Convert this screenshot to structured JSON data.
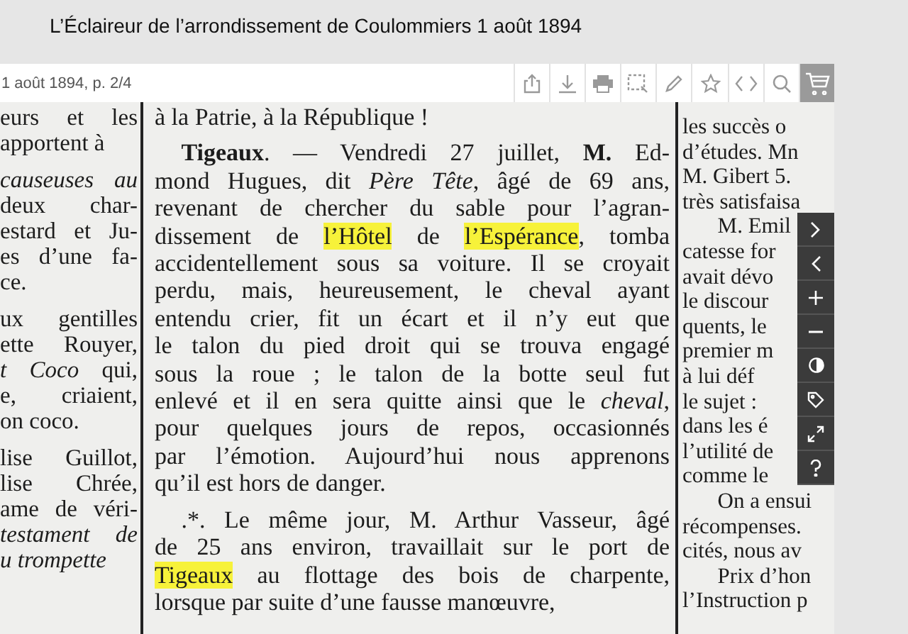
{
  "header": {
    "title": "L’Éclaireur de l’arrondissement de Coulommiers 1 août 1894"
  },
  "toolbar": {
    "page_label": "1 août 1894, p. 2/4"
  },
  "document": {
    "columns": [
      {
        "kind": "cut_left",
        "paragraphs": [
          {
            "lines": [
              "eurs et les",
              "apportent à"
            ]
          },
          {
            "lines": [
              "*causeuses au*",
              "deux char-",
              "estard et Ju-",
              "es d’une fa-",
              "ce."
            ]
          },
          {
            "lines": [
              "ux gentilles",
              "ette Rouyer,",
              "*t Coco* qui,",
              "e, criaient,",
              "on coco."
            ]
          },
          {
            "lines": [
              "lise Guillot,",
              "lise Chrée,",
              "ame de véri-",
              "*testament de*",
              "*u trompette*"
            ]
          }
        ]
      },
      {
        "kind": "full",
        "paragraphs": [
          {
            "continued": true,
            "lines": [
              "à la Patrie, à la République !"
            ]
          },
          {
            "continued": false,
            "lines": [
              "**Tigeaux**. — Vendredi 27 juillet, **M.** Ed-",
              "mond Hugues, dit *Père Tête*, âgé de 69 ans,",
              "revenant de chercher du sable pour l’agran-",
              {
                "segments": [
                  {
                    "text": "dissement de ",
                    "highlighted": false
                  },
                  {
                    "text": "l’Hôtel",
                    "highlighted": true
                  },
                  {
                    "text": " de ",
                    "highlighted": false
                  },
                  {
                    "text": "l’Espérance",
                    "highlighted": true
                  },
                  {
                    "text": ", tomba",
                    "highlighted": false
                  }
                ]
              },
              "accidentellement sous sa voiture. Il se croyait",
              "perdu, mais, heureusement, le cheval ayant",
              "entendu crier, fit un écart et il n’y eut que",
              "le talon du pied droit qui se trouva engagé",
              "sous la roue ; le talon de la botte seul fut",
              "enlevé et il en sera quitte ainsi que le *cheval*,",
              "pour quelques jours de repos, occasionnés",
              "par l’émotion. Aujourd’hui nous apprenons",
              "qu’il est hors de danger."
            ]
          },
          {
            "continued": false,
            "lines": [
              ".*. Le même jour, M. Arthur Vasseur, âgé",
              "de 25 ans environ, travaillait sur le port de",
              {
                "segments": [
                  {
                    "text": "Tigeaux",
                    "highlighted": true
                  },
                  {
                    "text": " au flottage des bois de charpente,",
                    "highlighted": false
                  }
                ]
              },
              "lorsque par suite d’une fausse manœuvre,"
            ]
          }
        ]
      },
      {
        "kind": "cut_right",
        "paragraphs": [
          {
            "continued": true,
            "lines": [
              "les succès o",
              "d’études. Mn",
              "M. Gibert 5.",
              "très satisfaisa"
            ]
          },
          {
            "continued": false,
            "lines": [
              "M. Emil",
              "catesse for",
              "avait dévo",
              "le discour",
              "quents, le",
              "premier m",
              "à lui déf",
              "le sujet :",
              "dans les é",
              "l’utilité de",
              "comme le"
            ]
          },
          {
            "continued": false,
            "lines": [
              "On a ensui",
              "récompenses.",
              "cités, nous av"
            ]
          },
          {
            "continued": false,
            "lines": [
              "Prix d’hon",
              "l’Instruction p"
            ]
          }
        ]
      }
    ]
  }
}
